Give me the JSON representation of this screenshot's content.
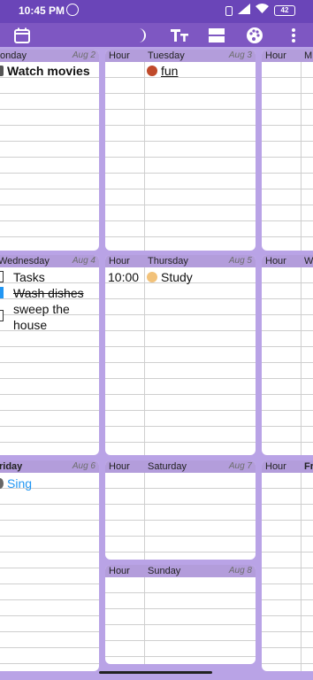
{
  "status": {
    "time": "10:45 PM",
    "battery": "42"
  },
  "toolbar": {
    "icons": [
      "calendar-icon",
      "moon-icon",
      "text-size-icon",
      "layout-icon",
      "palette-icon",
      "more-vert-icon"
    ]
  },
  "colors": {
    "toolbar": "#7e57c2",
    "statusbar": "#6a45b8",
    "header": "#b39ddb",
    "background": "#b9a3e6",
    "link": "#2196f3"
  },
  "hour_label": "Hour",
  "days": {
    "monday": {
      "name": "onday",
      "date": "Aug 2",
      "entry": "Watch movies"
    },
    "tuesday": {
      "name": "Tuesday",
      "date": "Aug 3",
      "entry": "fun"
    },
    "wednesday": {
      "name": "Wednesday",
      "date": "Aug 4",
      "tasks_title": "Tasks",
      "task1": "Wash dishes",
      "task2_line1": "sweep the",
      "task2_line2": "house"
    },
    "thursday": {
      "name": "Thursday",
      "date": "Aug 5",
      "time": "10:00",
      "entry": "Study"
    },
    "friday": {
      "name": "riday",
      "date": "Aug 6",
      "entry": "Sing"
    },
    "saturday": {
      "name": "Saturday",
      "date": "Aug 7"
    },
    "sunday": {
      "name": "Sunday",
      "date": "Aug 8"
    },
    "right_col": {
      "m": "M",
      "w": "W",
      "fr": "Fr"
    }
  }
}
